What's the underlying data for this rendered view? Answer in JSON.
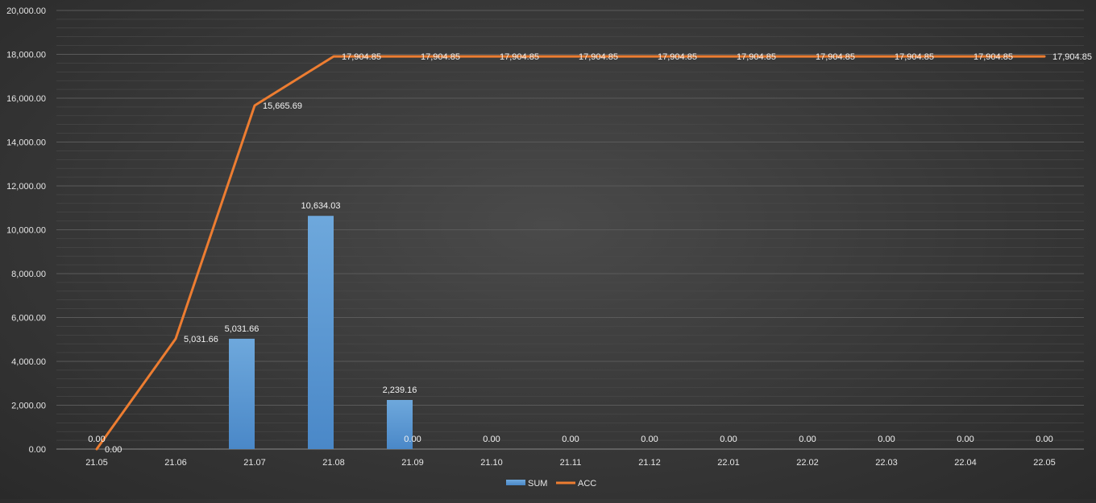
{
  "chart_data": {
    "type": "bar",
    "categories": [
      "21.05",
      "21.06",
      "21.07",
      "21.08",
      "21.09",
      "21.10",
      "21.11",
      "21.12",
      "22.01",
      "22.02",
      "22.03",
      "22.04",
      "22.05"
    ],
    "series": [
      {
        "name": "SUM",
        "type": "bar",
        "color": "#5b9bd5",
        "values": [
          0,
          5031.66,
          10634.03,
          2239.16,
          0,
          0,
          0,
          0,
          0,
          0,
          0,
          0,
          0
        ],
        "labels": [
          "0.00",
          "5,031.66",
          "10,634.03",
          "2,239.16",
          "0.00",
          "0.00",
          "0.00",
          "0.00",
          "0.00",
          "0.00",
          "0.00",
          "0.00",
          "0.00"
        ]
      },
      {
        "name": "ACC",
        "type": "line",
        "color": "#ed7d31",
        "values": [
          0,
          5031.66,
          15665.69,
          17904.85,
          17904.85,
          17904.85,
          17904.85,
          17904.85,
          17904.85,
          17904.85,
          17904.85,
          17904.85,
          17904.85
        ],
        "labels": [
          "0.00",
          "5,031.66",
          "15,665.69",
          "17,904.85",
          "17,904.85",
          "17,904.85",
          "17,904.85",
          "17,904.85",
          "17,904.85",
          "17,904.85",
          "17,904.85",
          "17,904.85",
          "17,904.85"
        ]
      }
    ],
    "ylim": [
      0,
      20000
    ],
    "yticks": [
      "0.00",
      "2,000.00",
      "4,000.00",
      "6,000.00",
      "8,000.00",
      "10,000.00",
      "12,000.00",
      "14,000.00",
      "16,000.00",
      "18,000.00",
      "20,000.00"
    ],
    "grid": true,
    "legend": "bottom-center",
    "title": "",
    "xlabel": "",
    "ylabel": ""
  }
}
